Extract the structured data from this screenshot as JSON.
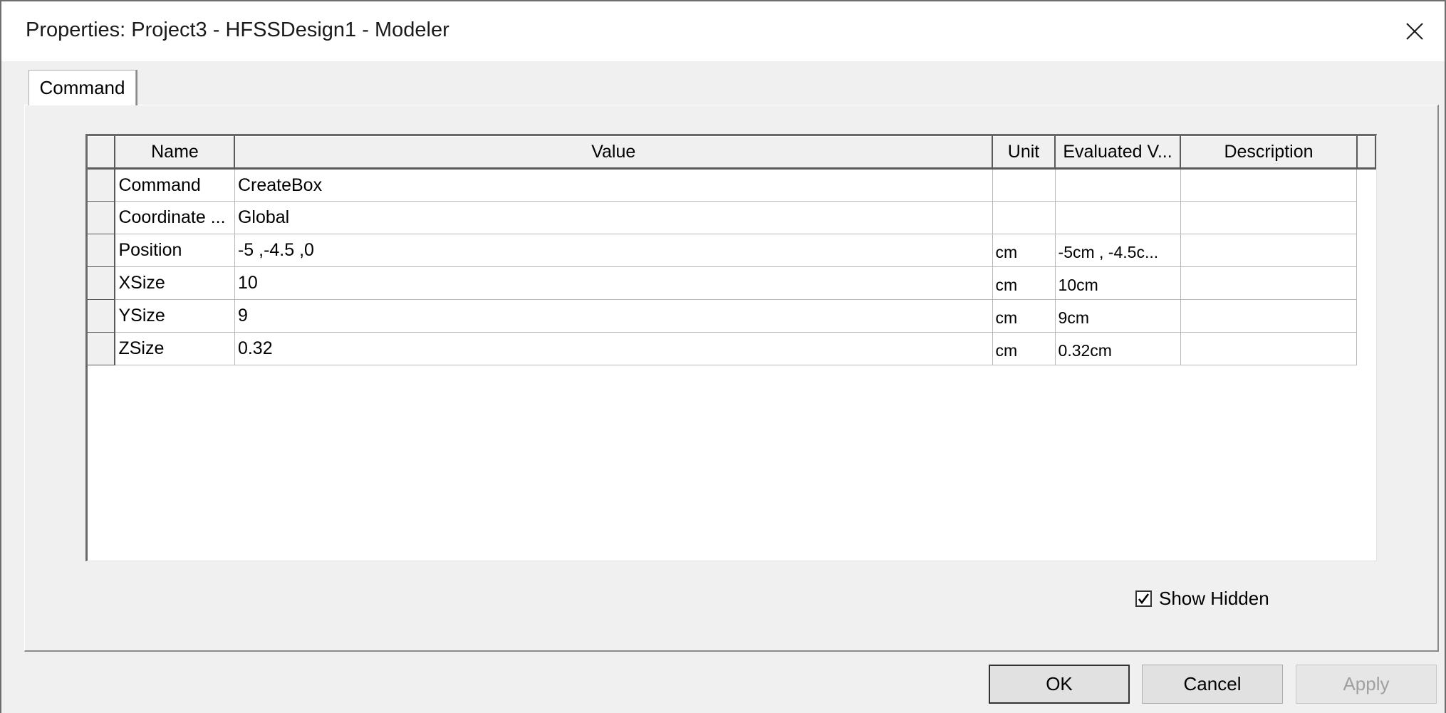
{
  "window": {
    "title": "Properties: Project3 - HFSSDesign1 - Modeler"
  },
  "tabs": [
    {
      "label": "Command",
      "active": true
    }
  ],
  "grid": {
    "columns": [
      "Name",
      "Value",
      "Unit",
      "Evaluated V...",
      "Description"
    ],
    "rows": [
      {
        "name": "Command",
        "value": "CreateBox",
        "unit": "",
        "evaluated": "",
        "description": ""
      },
      {
        "name": "Coordinate ...",
        "value": "Global",
        "unit": "",
        "evaluated": "",
        "description": ""
      },
      {
        "name": "Position",
        "value": "-5 ,-4.5 ,0",
        "unit": "cm",
        "evaluated": "-5cm , -4.5c...",
        "description": ""
      },
      {
        "name": "XSize",
        "value": "10",
        "unit": "cm",
        "evaluated": "10cm",
        "description": ""
      },
      {
        "name": "YSize",
        "value": "9",
        "unit": "cm",
        "evaluated": "9cm",
        "description": ""
      },
      {
        "name": "ZSize",
        "value": "0.32",
        "unit": "cm",
        "evaluated": "0.32cm",
        "description": ""
      }
    ]
  },
  "options": {
    "show_hidden_label": "Show Hidden",
    "show_hidden_checked": true
  },
  "buttons": {
    "ok": "OK",
    "cancel": "Cancel",
    "apply": "Apply"
  },
  "icons": {
    "close": "close-icon",
    "check": "checkmark-icon"
  }
}
